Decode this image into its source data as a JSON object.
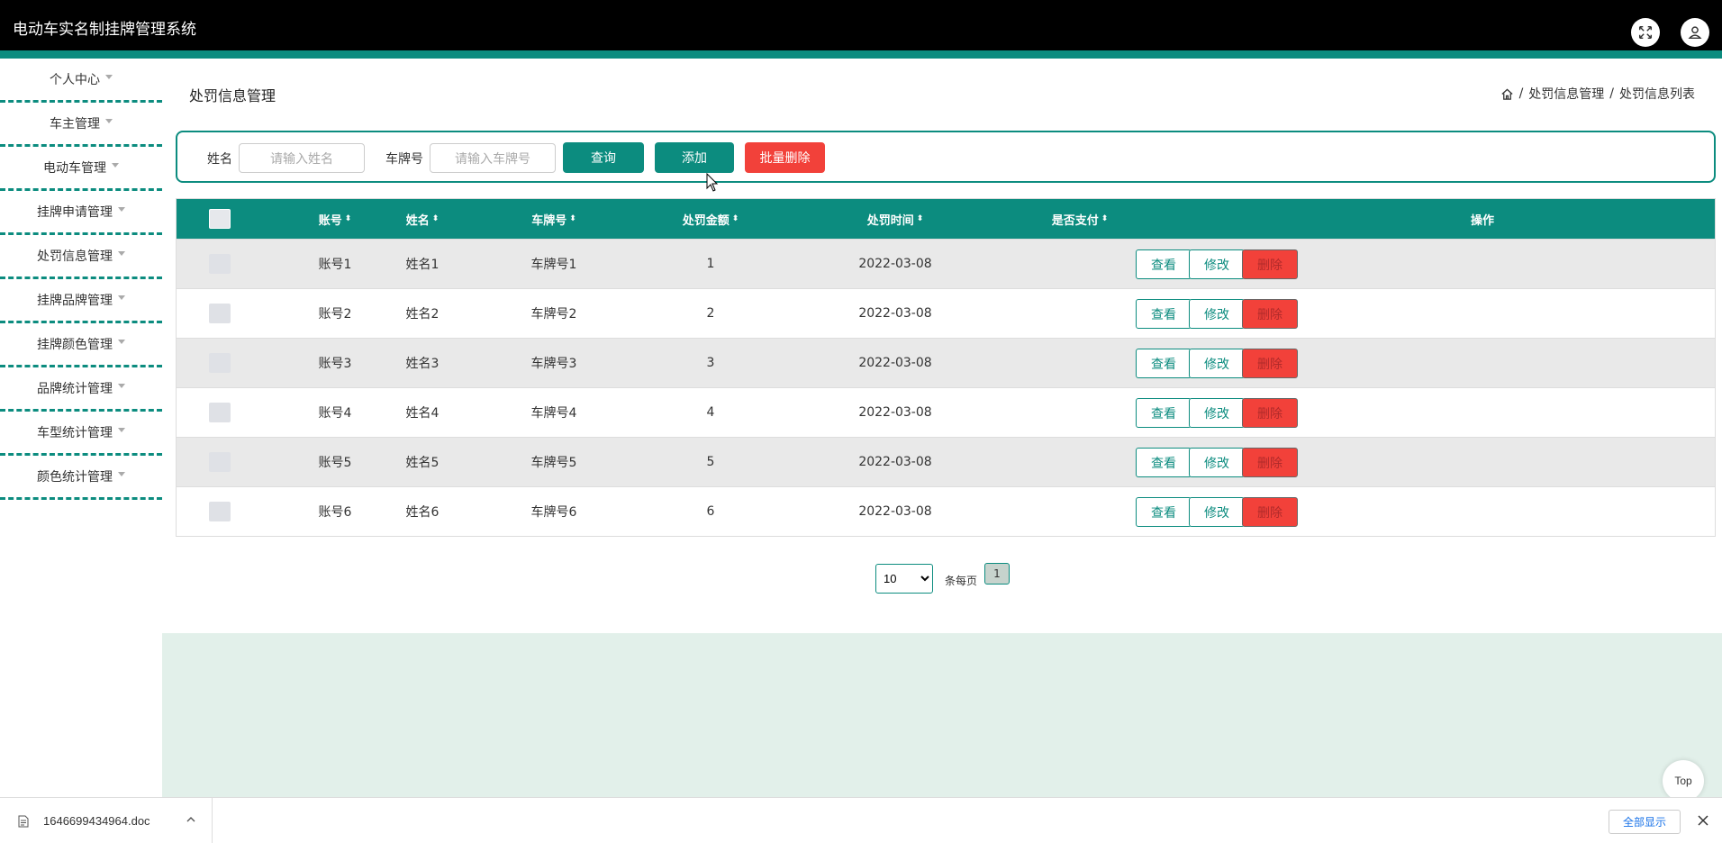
{
  "app": {
    "title": "电动车实名制挂牌管理系统"
  },
  "sidebar": {
    "items": [
      {
        "label": "个人中心"
      },
      {
        "label": "车主管理"
      },
      {
        "label": "电动车管理"
      },
      {
        "label": "挂牌申请管理"
      },
      {
        "label": "处罚信息管理"
      },
      {
        "label": "挂牌品牌管理"
      },
      {
        "label": "挂牌颜色管理"
      },
      {
        "label": "品牌统计管理"
      },
      {
        "label": "车型统计管理"
      },
      {
        "label": "颜色统计管理"
      }
    ]
  },
  "page": {
    "title": "处罚信息管理",
    "breadcrumb": [
      "处罚信息管理",
      "处罚信息列表"
    ],
    "breadcrumb_sep": "/"
  },
  "search": {
    "name_label": "姓名",
    "name_placeholder": "请输入姓名",
    "plate_label": "车牌号",
    "plate_placeholder": "请输入车牌号",
    "query_label": "查询",
    "add_label": "添加",
    "batch_delete_label": "批量删除"
  },
  "table": {
    "columns": [
      "账号",
      "姓名",
      "车牌号",
      "处罚金额",
      "处罚时间",
      "是否支付",
      "操作"
    ],
    "sort_glyph": "⬍",
    "rows": [
      {
        "account": "账号1",
        "name": "姓名1",
        "plate": "车牌号1",
        "amount": "1",
        "time": "2022-03-08",
        "paid": ""
      },
      {
        "account": "账号2",
        "name": "姓名2",
        "plate": "车牌号2",
        "amount": "2",
        "time": "2022-03-08",
        "paid": ""
      },
      {
        "account": "账号3",
        "name": "姓名3",
        "plate": "车牌号3",
        "amount": "3",
        "time": "2022-03-08",
        "paid": ""
      },
      {
        "account": "账号4",
        "name": "姓名4",
        "plate": "车牌号4",
        "amount": "4",
        "time": "2022-03-08",
        "paid": ""
      },
      {
        "account": "账号5",
        "name": "姓名5",
        "plate": "车牌号5",
        "amount": "5",
        "time": "2022-03-08",
        "paid": ""
      },
      {
        "account": "账号6",
        "name": "姓名6",
        "plate": "车牌号6",
        "amount": "6",
        "time": "2022-03-08",
        "paid": ""
      }
    ],
    "actions": {
      "view": "查看",
      "edit": "修改",
      "delete": "删除"
    }
  },
  "pagination": {
    "page_size": "10",
    "per_page_label": "条每页",
    "current_page": "1"
  },
  "top_button": "Top",
  "downloads": {
    "file_name": "1646699434964.doc",
    "show_all": "全部显示"
  },
  "colors": {
    "accent": "#0c8c7f",
    "danger": "#f2413a",
    "top_bar": "#000000",
    "footer_bg": "#e2f0ea"
  },
  "icons": {
    "fullscreen": "fullscreen-icon",
    "user": "user-icon",
    "home": "home-icon",
    "file": "file-icon",
    "chevron": "chevron-up-icon",
    "close": "close-icon",
    "cursor": "mouse-cursor-icon"
  }
}
